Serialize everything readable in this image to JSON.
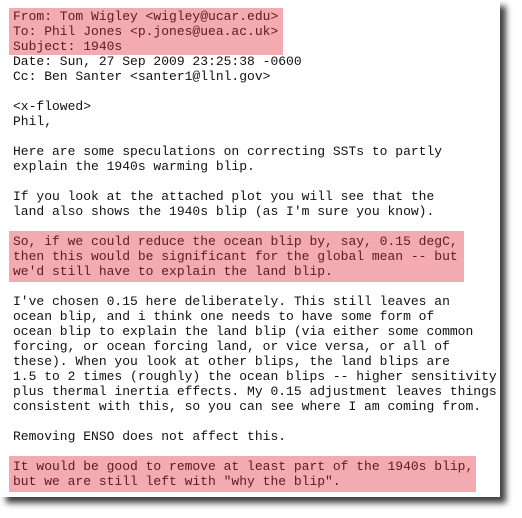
{
  "email": {
    "header": {
      "from": "From: Tom Wigley <wigley@ucar.edu>",
      "to": "To: Phil Jones <p.jones@uea.ac.uk>",
      "subject": "Subject: 1940s",
      "date": "Date: Sun, 27 Sep 2009 23:25:38 -0600",
      "cc": "Cc: Ben Santer <santer1@llnl.gov>"
    },
    "highlight_color": "#f3aab0",
    "body": {
      "format_tag": "<x-flowed>",
      "greeting": "Phil,",
      "p1": [
        "Here are some speculations on correcting SSTs to partly",
        "explain the 1940s warming blip."
      ],
      "p2": [
        "If you look at the attached plot you will see that the",
        "land also shows the 1940s blip (as I'm sure you know)."
      ],
      "p3": [
        "So, if we could reduce the ocean blip by, say, 0.15 degC,",
        "then this would be significant for the global mean -- but",
        "we'd still have to explain the land blip."
      ],
      "p4": [
        "I've chosen 0.15 here deliberately. This still leaves an",
        "ocean blip, and i think one needs to have some form of",
        "ocean blip to explain the land blip (via either some common",
        "forcing, or ocean forcing land, or vice versa, or all of",
        "these). When you look at other blips, the land blips are",
        "1.5 to 2 times (roughly) the ocean blips -- higher sensitivity",
        "plus thermal inertia effects. My 0.15 adjustment leaves things",
        "consistent with this, so you can see where I am coming from."
      ],
      "p5": [
        "Removing ENSO does not affect this."
      ],
      "p6": [
        "It would be good to remove at least part of the 1940s blip,",
        "but we are still left with \"why the blip\"."
      ]
    }
  }
}
